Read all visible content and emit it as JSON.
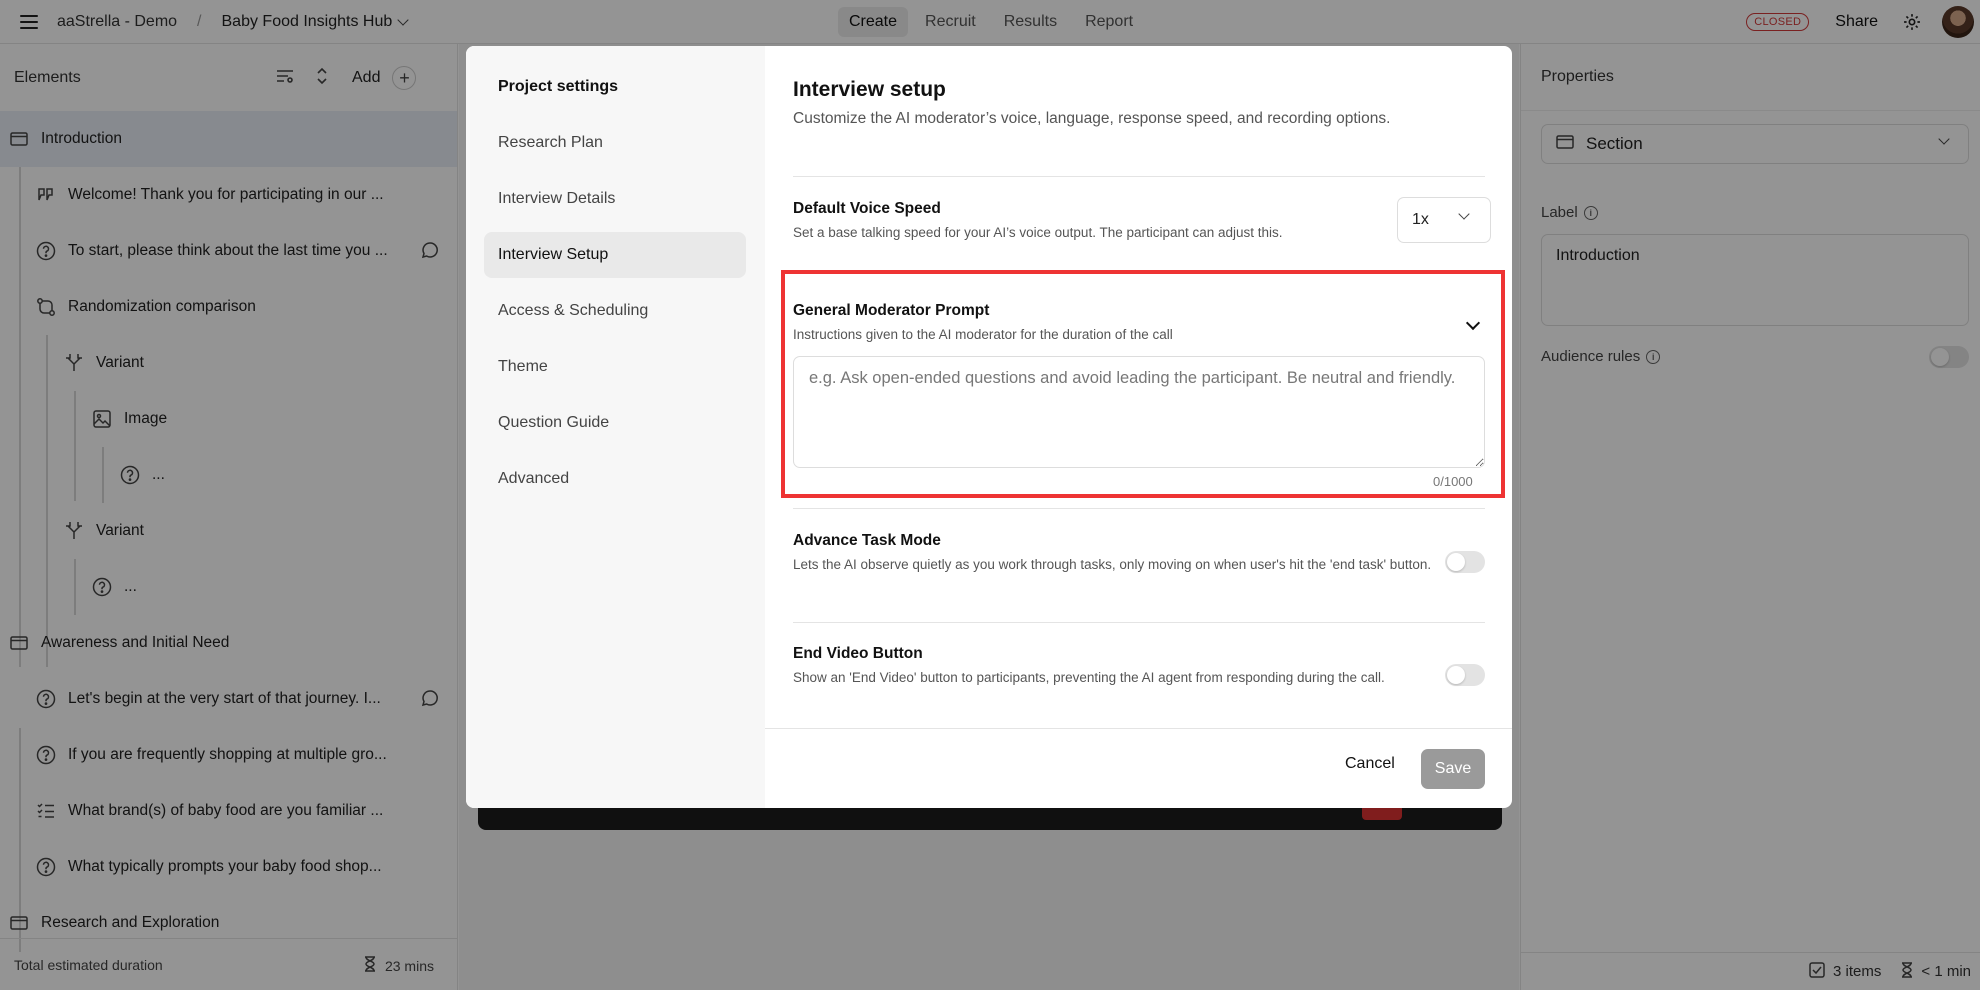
{
  "topbar": {
    "org": "aaStrella - Demo",
    "separator": "/",
    "project": "Baby Food Insights Hub",
    "nav": [
      "Create",
      "Recruit",
      "Results",
      "Report"
    ],
    "status_badge": "CLOSED",
    "share": "Share"
  },
  "left_panel": {
    "title": "Elements",
    "add_label": "Add",
    "items": [
      {
        "label": "Introduction",
        "icon": "section-icon"
      },
      {
        "label": "Welcome! Thank you for participating in our ...",
        "icon": "quote-icon"
      },
      {
        "label": "To start, please think about the last time you ...",
        "icon": "question-icon"
      },
      {
        "label": "Randomization comparison",
        "icon": "randomize-icon"
      },
      {
        "label": "Variant",
        "icon": "branch-icon"
      },
      {
        "label": "Image",
        "icon": "image-icon"
      },
      {
        "label": "...",
        "icon": "question-icon"
      },
      {
        "label": "Variant",
        "icon": "branch-icon"
      },
      {
        "label": "...",
        "icon": "question-icon"
      },
      {
        "label": "Awareness and Initial Need",
        "icon": "section-icon"
      },
      {
        "label": "Let's begin at the very start of that journey. I...",
        "icon": "question-icon"
      },
      {
        "label": "If you are frequently shopping at multiple gro...",
        "icon": "question-icon"
      },
      {
        "label": "What brand(s) of baby food are you familiar ...",
        "icon": "list-icon"
      },
      {
        "label": "What typically prompts your baby food shop...",
        "icon": "question-icon"
      },
      {
        "label": "Research and Exploration",
        "icon": "section-icon"
      }
    ],
    "footer_label": "Total estimated duration",
    "footer_duration": "23 mins"
  },
  "right_panel": {
    "title": "Properties",
    "type_select": "Section",
    "label_title": "Label",
    "label_value": "Introduction",
    "audience_rules": "Audience rules",
    "footer_items": "3 items",
    "footer_time": "< 1 min"
  },
  "modal": {
    "sidebar": {
      "heading": "Project settings",
      "items": [
        "Research Plan",
        "Interview Details",
        "Interview Setup",
        "Access & Scheduling",
        "Theme",
        "Question Guide",
        "Advanced"
      ],
      "active": "Interview Setup"
    },
    "title": "Interview setup",
    "subtitle": "Customize the AI moderator’s voice, language, response speed, and recording options.",
    "voice_speed": {
      "title": "Default Voice Speed",
      "desc": "Set a base talking speed for your AI’s voice output. The participant can adjust this.",
      "value": "1x"
    },
    "moderator_prompt": {
      "title": "General Moderator Prompt",
      "desc": "Instructions given to the AI moderator for the duration of the call",
      "placeholder": "e.g. Ask open-ended questions and avoid leading the participant. Be neutral and friendly.",
      "value": "",
      "counter": "0/1000"
    },
    "advance_task": {
      "title": "Advance Task Mode",
      "desc": "Lets the AI observe quietly as you work through tasks, only moving on when user's hit the 'end task' button."
    },
    "end_video": {
      "title": "End Video Button",
      "desc": "Show an 'End Video' button to participants, preventing the AI agent from responding during the call."
    },
    "cancel": "Cancel",
    "save": "Save"
  }
}
